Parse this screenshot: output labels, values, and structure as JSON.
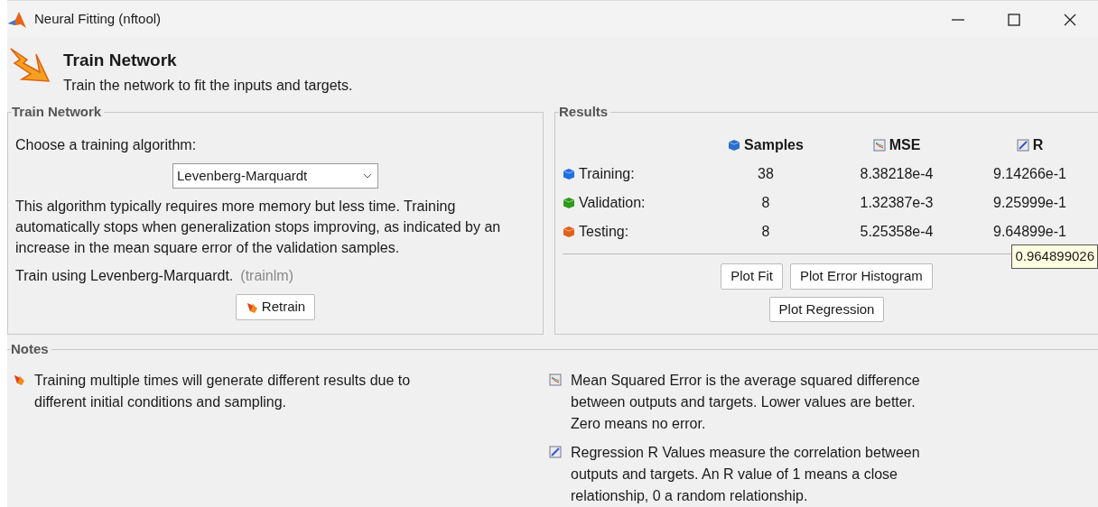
{
  "window": {
    "title": "Neural Fitting (nftool)"
  },
  "header": {
    "title": "Train Network",
    "subtitle": "Train the network to fit the inputs and targets."
  },
  "train_panel": {
    "title": "Train Network",
    "algorithm_label": "Choose a training algorithm:",
    "algorithm": "Levenberg-Marquardt",
    "description": "This algorithm typically requires more memory but less time. Training automatically stops when generalization stops improving, as indicated by an increase in the mean square error of the validation samples.",
    "using": "Train using Levenberg-Marquardt.",
    "using_code": "(trainlm)",
    "retrain_button": "Retrain"
  },
  "results": {
    "title": "Results",
    "columns": [
      "Samples",
      "MSE",
      "R"
    ],
    "rows": [
      {
        "label": "Training:",
        "color": "#1f6fe0",
        "samples": "38",
        "mse": "8.38218e-4",
        "r": "9.14266e-1"
      },
      {
        "label": "Validation:",
        "color": "#2e9a1c",
        "samples": "8",
        "mse": "1.32387e-3",
        "r": "9.25999e-1"
      },
      {
        "label": "Testing:",
        "color": "#e0621a",
        "samples": "8",
        "mse": "5.25358e-4",
        "r": "9.64899e-1"
      }
    ],
    "buttons": [
      "Plot Fit",
      "Plot Error Histogram",
      "Plot Regression"
    ],
    "tooltip": "0.964899026"
  },
  "notes": {
    "title": "Notes",
    "items": [
      {
        "kind": "train",
        "text": "Training multiple times will generate different results due to different initial conditions and sampling."
      },
      {
        "kind": "mse",
        "text": "Mean Squared Error is the average squared difference between outputs and targets. Lower values are better. Zero means no error."
      },
      {
        "kind": "r",
        "text": "Regression R Values measure the correlation between outputs and targets. An R value of 1 means a close relationship, 0 a random relationship."
      }
    ]
  }
}
